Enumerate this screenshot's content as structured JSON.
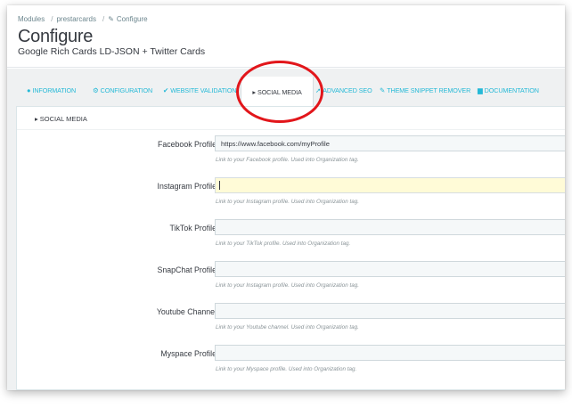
{
  "breadcrumb": {
    "items": [
      "Modules",
      "prestarcards",
      "Configure"
    ],
    "separator": "/"
  },
  "header": {
    "title": "Configure",
    "subtitle": "Google Rich Cards LD-JSON + Twitter Cards"
  },
  "tabs": [
    {
      "label": "INFORMATION",
      "icon": "info-circle-icon",
      "glyph": "●"
    },
    {
      "label": "CONFIGURATION",
      "icon": "cogs-icon",
      "glyph": "⚙"
    },
    {
      "label": "WEBSITE VALIDATION",
      "icon": "check-icon",
      "glyph": "✔"
    },
    {
      "label": "SOCIAL MEDIA",
      "icon": "bullhorn-icon",
      "glyph": "📢",
      "active": true
    },
    {
      "label": "ADVANCED SEO",
      "icon": "rocket-icon",
      "glyph": "➚"
    },
    {
      "label": "THEME SNIPPET REMOVER",
      "icon": "edit-icon",
      "glyph": "✎"
    },
    {
      "label": "DOCUMENTATION",
      "icon": "book-icon",
      "glyph": "▆"
    }
  ],
  "panel": {
    "heading": "SOCIAL MEDIA",
    "icon": "bullhorn-icon"
  },
  "fields": [
    {
      "label": "Facebook Profile",
      "value": "https://www.facebook.com/myProfile",
      "help": "Link to your Facebook profile. Used into Organization tag."
    },
    {
      "label": "Instagram Profile",
      "value": "",
      "help": "Link to your Instagram profile. Used into Organization tag.",
      "focused": true
    },
    {
      "label": "TikTok Profile",
      "value": "",
      "help": "Link to your TikTok profile. Used into Organization tag."
    },
    {
      "label": "SnapChat Profile",
      "value": "",
      "help": "Link to your Instagram profile. Used into Organization tag."
    },
    {
      "label": "Youtube Channel",
      "value": "",
      "help": "Link to your Youtube channel. Used into Organization tag."
    },
    {
      "label": "Myspace Profile",
      "value": "",
      "help": "Link to your Myspace profile. Used into Organization tag."
    }
  ],
  "colors": {
    "accent": "#25b9d7",
    "annotation": "#e2161b",
    "focus_bg": "#fffbd7"
  }
}
